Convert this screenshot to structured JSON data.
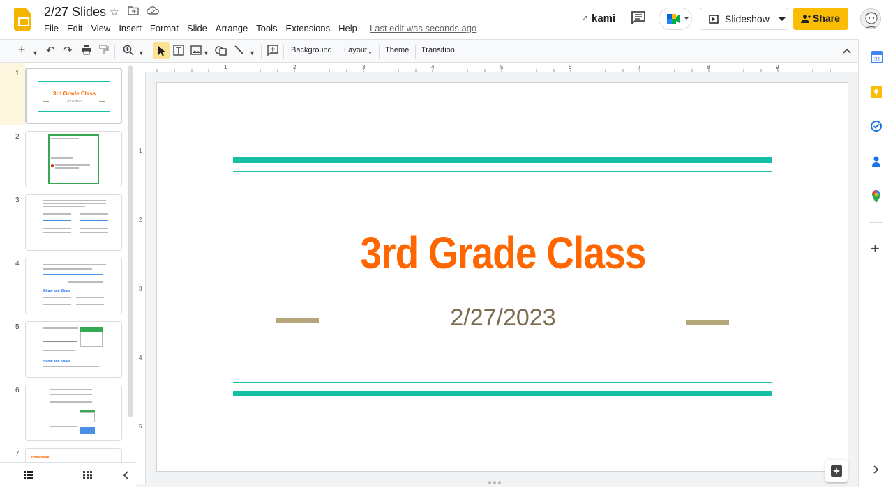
{
  "app": {
    "doc_title": "2/27 Slides",
    "last_edit": "Last edit was seconds ago"
  },
  "menu": [
    "File",
    "Edit",
    "View",
    "Insert",
    "Format",
    "Slide",
    "Arrange",
    "Tools",
    "Extensions",
    "Help"
  ],
  "header_actions": {
    "kami": "kami",
    "slideshow": "Slideshow",
    "share": "Share"
  },
  "toolbar": {
    "background": "Background",
    "layout": "Layout",
    "theme": "Theme",
    "transition": "Transition"
  },
  "ruler": {
    "horizontal": [
      "1",
      "2",
      "3",
      "4",
      "5",
      "6",
      "7",
      "8",
      "9"
    ],
    "vertical": [
      "1",
      "2",
      "3",
      "4",
      "5"
    ]
  },
  "filmstrip": {
    "slides": [
      {
        "num": "1",
        "title": "3rd Grade Class",
        "subtitle": "2/27/2023"
      },
      {
        "num": "2"
      },
      {
        "num": "3"
      },
      {
        "num": "4",
        "caption": "Show and Share"
      },
      {
        "num": "5",
        "caption": "Show and Share"
      },
      {
        "num": "6"
      },
      {
        "num": "7",
        "caption": "Homework"
      }
    ]
  },
  "slide": {
    "title": "3rd Grade Class",
    "subtitle": "2/27/2023"
  },
  "colors": {
    "accent_teal": "#14bfa6",
    "title_orange": "#ff6600",
    "tan": "#b5a57a",
    "share_yellow": "#fbbc04"
  }
}
